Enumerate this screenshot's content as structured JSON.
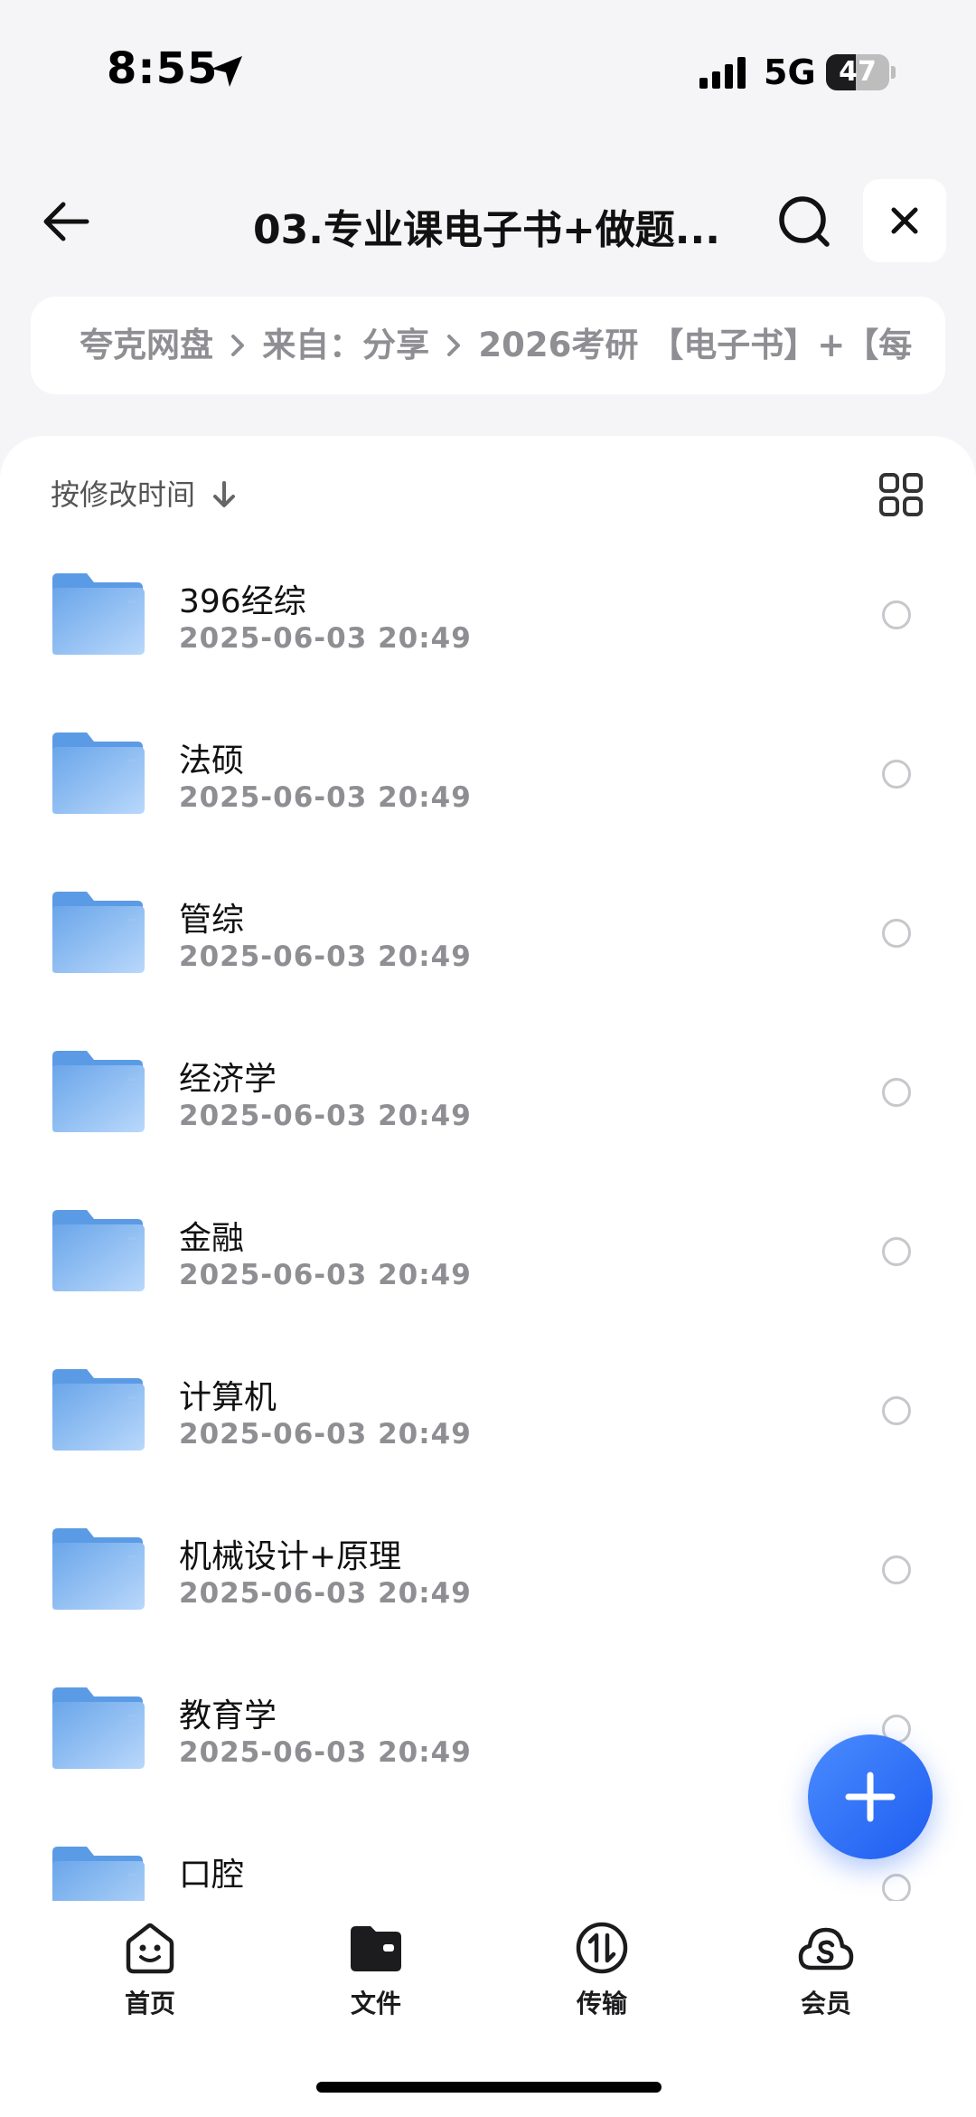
{
  "status_bar": {
    "time": "8:55",
    "network": "5G",
    "battery": "47",
    "battery_level": 0.47
  },
  "header": {
    "title": "03.专业课电子书+做题...",
    "back_icon": "arrow-left-icon",
    "search_icon": "search-icon",
    "close_icon": "close-icon"
  },
  "breadcrumb": {
    "items": [
      "夸克网盘",
      "来自：分享",
      "2026考研 【电子书】+【每"
    ]
  },
  "toolbar": {
    "sort_label": "按修改时间",
    "sort_icon": "arrow-down-icon",
    "view_icon": "grid-view-icon"
  },
  "files": [
    {
      "name": "396经综",
      "date": "2025-06-03 20:49"
    },
    {
      "name": "法硕",
      "date": "2025-06-03 20:49"
    },
    {
      "name": "管综",
      "date": "2025-06-03 20:49"
    },
    {
      "name": "经济学",
      "date": "2025-06-03 20:49"
    },
    {
      "name": "金融",
      "date": "2025-06-03 20:49"
    },
    {
      "name": "计算机",
      "date": "2025-06-03 20:49"
    },
    {
      "name": "机械设计+原理",
      "date": "2025-06-03 20:49"
    },
    {
      "name": "教育学",
      "date": "2025-06-03 20:49"
    },
    {
      "name": "口腔",
      "date": ""
    }
  ],
  "fab": {
    "icon": "plus-icon"
  },
  "tabs": [
    {
      "label": "首页",
      "icon": "smiley-home-icon"
    },
    {
      "label": "文件",
      "icon": "folder-icon"
    },
    {
      "label": "传输",
      "icon": "transfer-icon"
    },
    {
      "label": "会员",
      "icon": "cloud-s-icon"
    }
  ],
  "colors": {
    "accent": "#1e5cf0",
    "folder": "#7fb3ee",
    "secondary_text": "#8e8e93",
    "background": "#f5f5f7"
  }
}
